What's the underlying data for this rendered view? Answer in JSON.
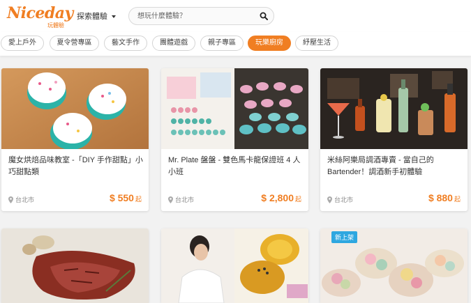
{
  "brand": {
    "name": "Niceday",
    "subtitle": "玩體驗"
  },
  "nav": {
    "explore_label": "探索體驗"
  },
  "search": {
    "placeholder": "想玩什麼體驗？"
  },
  "categories": [
    {
      "label": "愛上戶外",
      "active": false
    },
    {
      "label": "夏令營專區",
      "active": false
    },
    {
      "label": "藝文手作",
      "active": false
    },
    {
      "label": "團體遊戲",
      "active": false
    },
    {
      "label": "親子專區",
      "active": false
    },
    {
      "label": "玩樂廚房",
      "active": true
    },
    {
      "label": "紓壓生活",
      "active": false
    }
  ],
  "cards": [
    {
      "title": "魔女烘焙品味教室 -「DIY 手作甜點」小巧甜點類",
      "location": "台北市",
      "price": "$ 550",
      "price_suffix": "起"
    },
    {
      "title": "Mr. Plate 盤盤 - 雙色馬卡龍保證班 4 人小班",
      "location": "台北市",
      "price": "$ 2,800",
      "price_suffix": "起"
    },
    {
      "title": "米絲阿樂局調酒專賣 - 當自己的 Bartender！調酒新手初體驗",
      "location": "台北市",
      "price": "$ 880",
      "price_suffix": "起"
    }
  ],
  "bottom_cards": [
    {
      "badge": ""
    },
    {
      "badge": ""
    },
    {
      "badge": "新上架"
    }
  ],
  "colors": {
    "accent": "#f07e22",
    "badge": "#2ea7e0"
  }
}
